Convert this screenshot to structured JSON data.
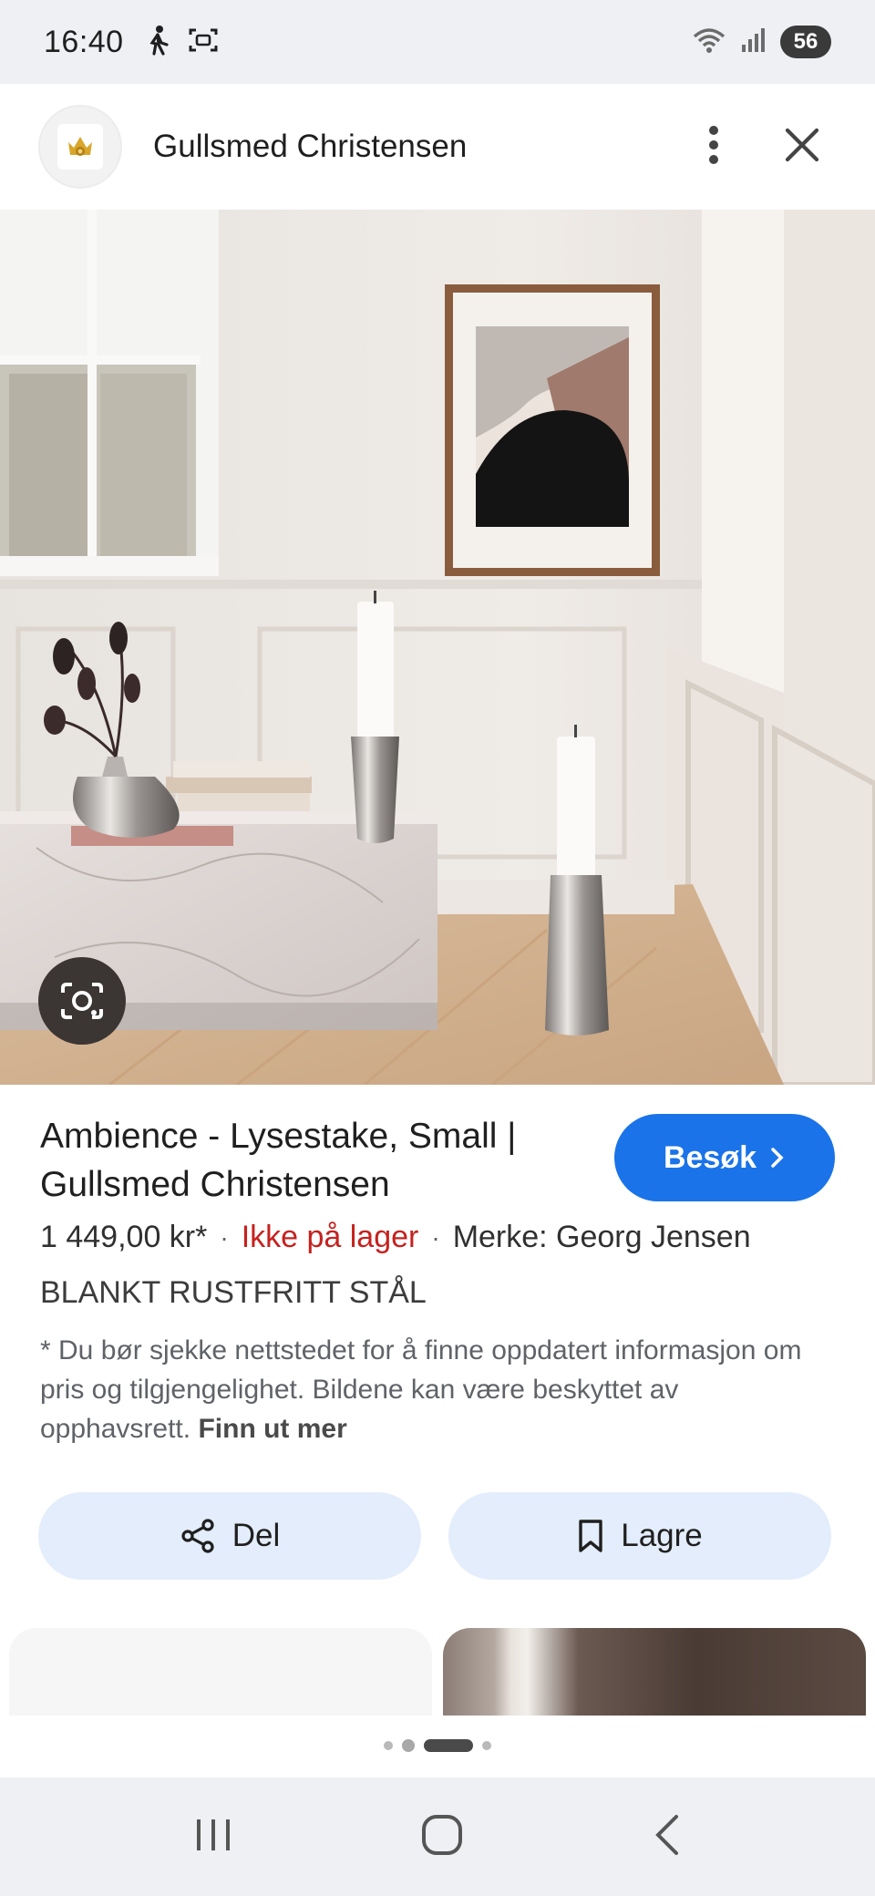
{
  "status_bar": {
    "time": "16:40",
    "battery": "56"
  },
  "header": {
    "site_name": "Gullsmed Christensen"
  },
  "product": {
    "title": "Ambience - Lysestake, Small | Gullsmed Christensen",
    "visit_label": "Besøk",
    "price": "1 449,00 kr*",
    "stock": "Ikke på lager",
    "brand": "Merke: Georg Jensen",
    "material": "BLANKT RUSTFRITT STÅL",
    "disclaimer": "* Du bør sjekke nettstedet for å finne oppdatert informasjon om pris og tilgjengelighet. Bildene kan være beskyttet av opphavsrett.",
    "learn_more": "Finn ut mer"
  },
  "actions": {
    "share_label": "Del",
    "save_label": "Lagre"
  },
  "colors": {
    "accent": "#1a73e8",
    "stock_red": "#c5221f",
    "action_bg": "#e3edfb"
  }
}
